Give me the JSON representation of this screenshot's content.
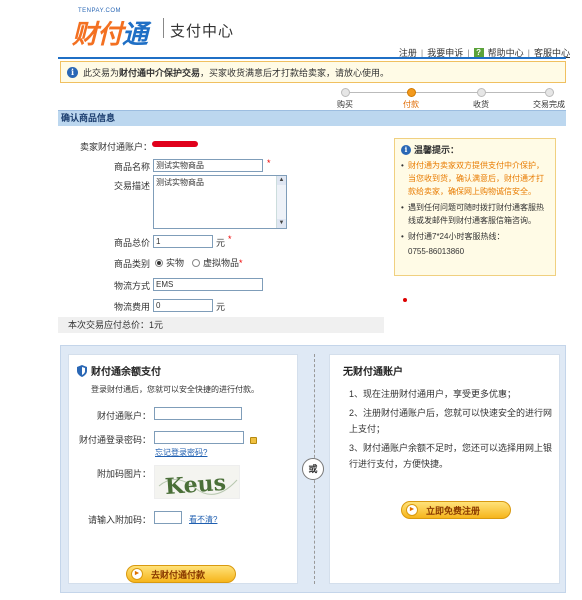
{
  "header": {
    "logo_small": "TENPAY.COM",
    "logo_text_1": "财付",
    "logo_text_2": "通",
    "subtitle": "支付中心",
    "links": [
      "注册",
      "我要申诉",
      "帮助中心",
      "客服中心"
    ]
  },
  "notice": {
    "prefix": "此交易为",
    "bold": "财付通中介保护交易",
    "suffix": "，买家收货满意后才打款给卖家，请放心使用。"
  },
  "steps": [
    {
      "label": "购买",
      "active": false
    },
    {
      "label": "付款",
      "active": true
    },
    {
      "label": "收货",
      "active": false
    },
    {
      "label": "交易完成",
      "active": false
    }
  ],
  "section_title": "确认商品信息",
  "form": {
    "seller_label": "卖家财付通账户：",
    "name_label": "商品名称",
    "name_value": "测试实物商品",
    "desc_label": "交易描述",
    "desc_value": "测试实物商品",
    "price_label": "商品总价",
    "price_value": "1",
    "price_unit": "元",
    "type_label": "商品类别",
    "type_options": [
      "实物",
      "虚拟物品"
    ],
    "ship_label": "物流方式",
    "ship_value": "EMS",
    "fee_label": "物流费用",
    "fee_value": "0",
    "fee_unit": "元",
    "total_text": "本次交易应付总价：1元"
  },
  "tips": {
    "title": "温馨提示：",
    "items": [
      "财付通为卖家双方提供支付中介保护，当您收到货，确认满意后，财付通才打款给卖家，确保网上购物诚信安全。",
      "遇到任何问题可随时拨打财付通客服热线或发邮件到财付通客服信箱咨询。",
      "财付通7*24小时客服热线："
    ],
    "phone": "0755-86013860"
  },
  "pay": {
    "left": {
      "title": "财付通余额支付",
      "desc": "登录财付通后，您就可以安全快捷的进行付款。",
      "account_label": "财付通账户：",
      "password_label": "财付通登录密码：",
      "forgot": "忘记登录密码?",
      "captcha_label": "附加码图片：",
      "captcha_text": "Keus",
      "code_label": "请输入附加码：",
      "refresh": "看不清?",
      "button": "去财付通付款"
    },
    "or": "或",
    "right": {
      "title": "无财付通账户",
      "items": [
        "1、现在注册财付通用户，享受更多优惠；",
        "2、注册财付通账户后，您就可以快速安全的进行网上支付；",
        "3、财付通账户余额不足时，您还可以选择用网上银行进行支付，方便快捷。"
      ],
      "button": "立即免费注册"
    }
  },
  "colors": {
    "brand_blue": "#1f6fc5",
    "brand_orange": "#f37021",
    "required": "#e00"
  }
}
